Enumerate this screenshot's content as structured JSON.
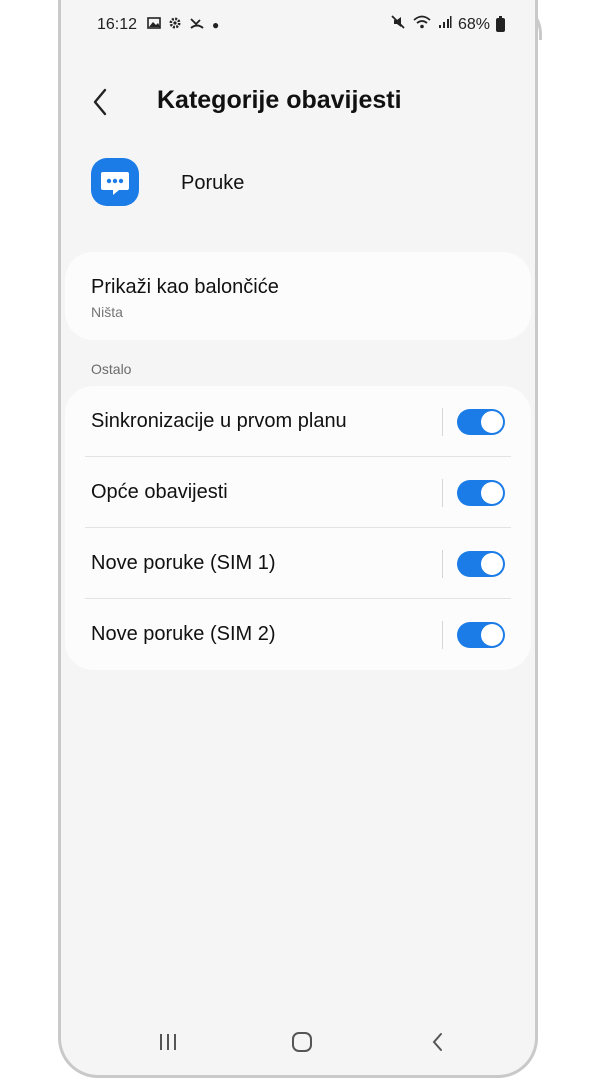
{
  "status_bar": {
    "time": "16:12",
    "battery": "68%"
  },
  "header": {
    "title": "Kategorije obavijesti"
  },
  "app": {
    "name": "Poruke"
  },
  "bubbles": {
    "title": "Prikaži kao balončiće",
    "value": "Ništa"
  },
  "section": {
    "label": "Ostalo"
  },
  "categories": [
    {
      "label": "Sinkronizacije u prvom planu",
      "enabled": true
    },
    {
      "label": "Opće obavijesti",
      "enabled": true
    },
    {
      "label": "Nove poruke (SIM 1)",
      "enabled": true
    },
    {
      "label": "Nove poruke (SIM 2)",
      "enabled": true
    }
  ],
  "colors": {
    "accent": "#1b7ce8",
    "background": "#f5f5f5",
    "card": "#fcfcfc"
  }
}
